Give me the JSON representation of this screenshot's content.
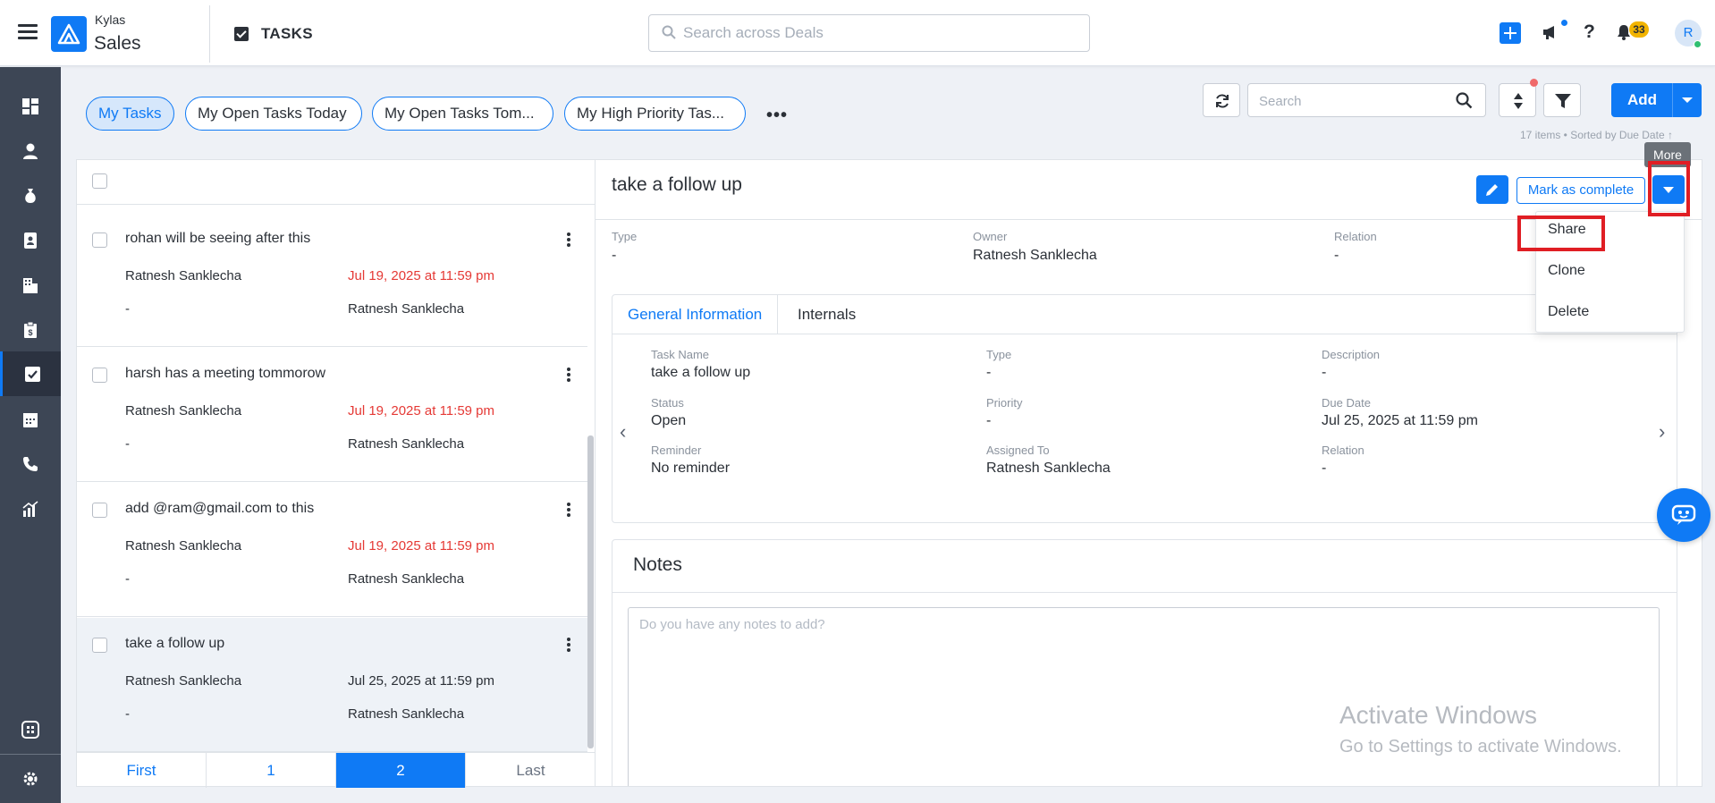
{
  "header": {
    "brand_top": "Kylas",
    "brand_main": "Sales",
    "page_title": "TASKS",
    "search_placeholder": "Search across Deals",
    "notification_count": "33",
    "avatar_initial": "R"
  },
  "sidebar": {
    "items": [
      "dashboard-icon",
      "contacts-icon",
      "deals-icon",
      "leads-icon",
      "companies-icon",
      "quotes-icon",
      "tasks-icon",
      "calendar-icon",
      "calls-icon",
      "reports-icon"
    ],
    "active": "tasks-icon",
    "bottom_items": [
      "apps-icon",
      "settings-icon"
    ]
  },
  "views": {
    "tabs": [
      "My Tasks",
      "My Open Tasks Today",
      "My Open Tasks Tom...",
      "My High Priority Tas..."
    ],
    "selected": "My Tasks"
  },
  "toolbar": {
    "search_placeholder": "Search",
    "add_label": "Add",
    "items_info": "17 items • Sorted by  Due Date ↑"
  },
  "tasks": [
    {
      "title": "rohan will be seeing after this",
      "owner": "Ratnesh Sanklecha",
      "due": "Jul 19, 2025 at 11:59 pm",
      "overdue": true,
      "related": "-",
      "assignee": "Ratnesh Sanklecha"
    },
    {
      "title": "harsh has a meeting tommorow",
      "owner": "Ratnesh Sanklecha",
      "due": "Jul 19, 2025 at 11:59 pm",
      "overdue": true,
      "related": "-",
      "assignee": "Ratnesh Sanklecha"
    },
    {
      "title": "add @ram@gmail.com to this",
      "owner": "Ratnesh Sanklecha",
      "due": "Jul 19, 2025 at 11:59 pm",
      "overdue": true,
      "related": "-",
      "assignee": "Ratnesh Sanklecha"
    },
    {
      "title": "take a follow up",
      "owner": "Ratnesh Sanklecha",
      "due": "Jul 25, 2025 at 11:59 pm",
      "overdue": false,
      "related": "-",
      "assignee": "Ratnesh Sanklecha"
    }
  ],
  "pagination": {
    "first": "First",
    "page1": "1",
    "page2": "2",
    "last": "Last",
    "current": "2"
  },
  "detail": {
    "title": "take a follow up",
    "mark_complete_label": "Mark as complete",
    "more_tooltip": "More",
    "meta": {
      "type_label": "Type",
      "type_value": "-",
      "owner_label": "Owner",
      "owner_value": "Ratnesh Sanklecha",
      "relation_label": "Relation",
      "relation_value": "-"
    },
    "tabs": [
      "General Information",
      "Internals"
    ],
    "fields": {
      "task_name_label": "Task Name",
      "task_name_value": "take a follow up",
      "type_label": "Type",
      "type_value": "-",
      "description_label": "Description",
      "description_value": "-",
      "status_label": "Status",
      "status_value": "Open",
      "priority_label": "Priority",
      "priority_value": "-",
      "due_date_label": "Due Date",
      "due_date_value": "Jul 25, 2025 at 11:59 pm",
      "reminder_label": "Reminder",
      "reminder_value": "No reminder",
      "assigned_to_label": "Assigned To",
      "assigned_to_value": "Ratnesh Sanklecha",
      "relation_label": "Relation",
      "relation_value": "-"
    },
    "notes_title": "Notes",
    "notes_placeholder": "Do you have any notes to add?"
  },
  "more_menu": {
    "items": [
      "Share",
      "Clone",
      "Delete"
    ]
  },
  "watermark": {
    "line1": "Activate Windows",
    "line2": "Go to Settings to activate Windows."
  },
  "colors": {
    "accent": "#0f7af5",
    "sidebar": "#3d4655",
    "overdue": "#e53935",
    "highlight": "#e01e24"
  }
}
